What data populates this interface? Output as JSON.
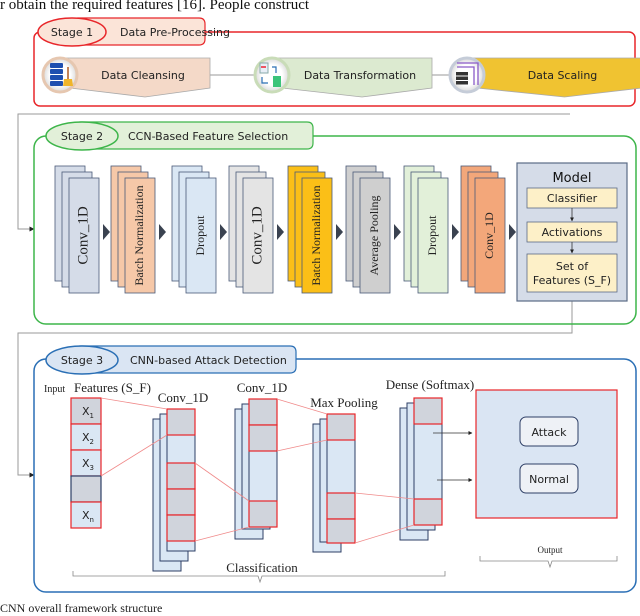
{
  "top_text": "r obtain the required features [16]. People construct",
  "caption": "CNN overall framework structure",
  "colors": {
    "stage1": "#e8262a",
    "stage2": "#3db54a",
    "stage3": "#2a6fb5",
    "stage1_tab_bg": "#fbe4d8",
    "stage2_tab_bg": "#e2f0d9",
    "stage3_tab_bg": "#dae5f3"
  },
  "stage1": {
    "badge": "Stage 1",
    "title": "Data Pre-Processing",
    "steps": [
      {
        "label": "Data Cleansing",
        "icon": "database-broom-icon",
        "color": "#f4d9c8"
      },
      {
        "label": "Data Transformation",
        "icon": "document-transform-icon",
        "color": "#dcead0"
      },
      {
        "label": "Data Scaling",
        "icon": "scaling-icon",
        "color": "#f0c331"
      }
    ]
  },
  "stage2": {
    "badge": "Stage 2",
    "title": "CCN-Based Feature Selection",
    "layers": [
      {
        "label": "Conv_1D",
        "color": "#d5dce8",
        "font": "large"
      },
      {
        "label": "Batch Normalization",
        "color": "#f6c8a8",
        "font": "small"
      },
      {
        "label": "Dropout",
        "color": "#dae7f4",
        "font": "small"
      },
      {
        "label": "Conv_1D",
        "color": "#e4e4e4",
        "font": "large"
      },
      {
        "label": "Batch Normalization",
        "color": "#fbbf17",
        "font": "small"
      },
      {
        "label": "Average Pooling",
        "color": "#cfcfcf",
        "font": "small"
      },
      {
        "label": "Dropout",
        "color": "#e2f0d9",
        "font": "small"
      },
      {
        "label": "Conv_1D",
        "color": "#f3a77a",
        "font": "small"
      }
    ],
    "model": {
      "title": "Model",
      "items": [
        "Classifier",
        "Activations",
        "Set of Features (S_F)"
      ],
      "item_lines": [
        [
          "Classifier"
        ],
        [
          "Activations"
        ],
        [
          "Set of",
          "Features (S_F)"
        ]
      ]
    }
  },
  "stage3": {
    "badge": "Stage 3",
    "title": "CNN-based Attack Detection",
    "input_label_prefix": "Input",
    "input_label": "Features (S_F)",
    "features": [
      {
        "base": "X",
        "sub": "1"
      },
      {
        "base": "X",
        "sub": "2"
      },
      {
        "base": "X",
        "sub": "3"
      },
      {
        "base": "",
        "sub": ""
      },
      {
        "base": "X",
        "sub": "n"
      }
    ],
    "layers": [
      "Conv_1D",
      "Conv_1D",
      "Max Pooling",
      "Dense (Softmax)"
    ],
    "outputs": [
      "Attack",
      "Normal"
    ],
    "classification_label": "Classification",
    "output_label": "Output"
  }
}
